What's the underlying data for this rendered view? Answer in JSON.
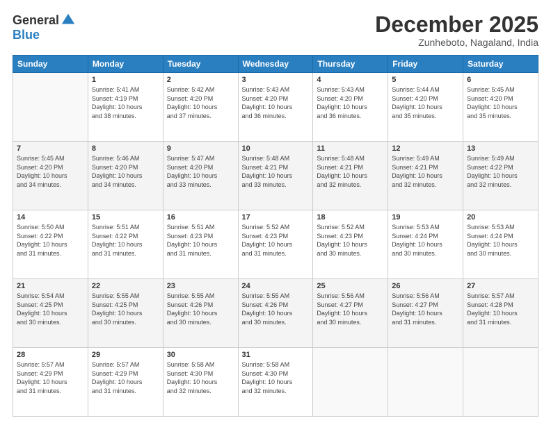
{
  "logo": {
    "general": "General",
    "blue": "Blue"
  },
  "header": {
    "month": "December 2025",
    "location": "Zunheboto, Nagaland, India"
  },
  "days_of_week": [
    "Sunday",
    "Monday",
    "Tuesday",
    "Wednesday",
    "Thursday",
    "Friday",
    "Saturday"
  ],
  "weeks": [
    [
      {
        "day": "",
        "info": ""
      },
      {
        "day": "1",
        "info": "Sunrise: 5:41 AM\nSunset: 4:19 PM\nDaylight: 10 hours\nand 38 minutes."
      },
      {
        "day": "2",
        "info": "Sunrise: 5:42 AM\nSunset: 4:20 PM\nDaylight: 10 hours\nand 37 minutes."
      },
      {
        "day": "3",
        "info": "Sunrise: 5:43 AM\nSunset: 4:20 PM\nDaylight: 10 hours\nand 36 minutes."
      },
      {
        "day": "4",
        "info": "Sunrise: 5:43 AM\nSunset: 4:20 PM\nDaylight: 10 hours\nand 36 minutes."
      },
      {
        "day": "5",
        "info": "Sunrise: 5:44 AM\nSunset: 4:20 PM\nDaylight: 10 hours\nand 35 minutes."
      },
      {
        "day": "6",
        "info": "Sunrise: 5:45 AM\nSunset: 4:20 PM\nDaylight: 10 hours\nand 35 minutes."
      }
    ],
    [
      {
        "day": "7",
        "info": "Sunrise: 5:45 AM\nSunset: 4:20 PM\nDaylight: 10 hours\nand 34 minutes."
      },
      {
        "day": "8",
        "info": "Sunrise: 5:46 AM\nSunset: 4:20 PM\nDaylight: 10 hours\nand 34 minutes."
      },
      {
        "day": "9",
        "info": "Sunrise: 5:47 AM\nSunset: 4:20 PM\nDaylight: 10 hours\nand 33 minutes."
      },
      {
        "day": "10",
        "info": "Sunrise: 5:48 AM\nSunset: 4:21 PM\nDaylight: 10 hours\nand 33 minutes."
      },
      {
        "day": "11",
        "info": "Sunrise: 5:48 AM\nSunset: 4:21 PM\nDaylight: 10 hours\nand 32 minutes."
      },
      {
        "day": "12",
        "info": "Sunrise: 5:49 AM\nSunset: 4:21 PM\nDaylight: 10 hours\nand 32 minutes."
      },
      {
        "day": "13",
        "info": "Sunrise: 5:49 AM\nSunset: 4:22 PM\nDaylight: 10 hours\nand 32 minutes."
      }
    ],
    [
      {
        "day": "14",
        "info": "Sunrise: 5:50 AM\nSunset: 4:22 PM\nDaylight: 10 hours\nand 31 minutes."
      },
      {
        "day": "15",
        "info": "Sunrise: 5:51 AM\nSunset: 4:22 PM\nDaylight: 10 hours\nand 31 minutes."
      },
      {
        "day": "16",
        "info": "Sunrise: 5:51 AM\nSunset: 4:23 PM\nDaylight: 10 hours\nand 31 minutes."
      },
      {
        "day": "17",
        "info": "Sunrise: 5:52 AM\nSunset: 4:23 PM\nDaylight: 10 hours\nand 31 minutes."
      },
      {
        "day": "18",
        "info": "Sunrise: 5:52 AM\nSunset: 4:23 PM\nDaylight: 10 hours\nand 30 minutes."
      },
      {
        "day": "19",
        "info": "Sunrise: 5:53 AM\nSunset: 4:24 PM\nDaylight: 10 hours\nand 30 minutes."
      },
      {
        "day": "20",
        "info": "Sunrise: 5:53 AM\nSunset: 4:24 PM\nDaylight: 10 hours\nand 30 minutes."
      }
    ],
    [
      {
        "day": "21",
        "info": "Sunrise: 5:54 AM\nSunset: 4:25 PM\nDaylight: 10 hours\nand 30 minutes."
      },
      {
        "day": "22",
        "info": "Sunrise: 5:55 AM\nSunset: 4:25 PM\nDaylight: 10 hours\nand 30 minutes."
      },
      {
        "day": "23",
        "info": "Sunrise: 5:55 AM\nSunset: 4:26 PM\nDaylight: 10 hours\nand 30 minutes."
      },
      {
        "day": "24",
        "info": "Sunrise: 5:55 AM\nSunset: 4:26 PM\nDaylight: 10 hours\nand 30 minutes."
      },
      {
        "day": "25",
        "info": "Sunrise: 5:56 AM\nSunset: 4:27 PM\nDaylight: 10 hours\nand 30 minutes."
      },
      {
        "day": "26",
        "info": "Sunrise: 5:56 AM\nSunset: 4:27 PM\nDaylight: 10 hours\nand 31 minutes."
      },
      {
        "day": "27",
        "info": "Sunrise: 5:57 AM\nSunset: 4:28 PM\nDaylight: 10 hours\nand 31 minutes."
      }
    ],
    [
      {
        "day": "28",
        "info": "Sunrise: 5:57 AM\nSunset: 4:29 PM\nDaylight: 10 hours\nand 31 minutes."
      },
      {
        "day": "29",
        "info": "Sunrise: 5:57 AM\nSunset: 4:29 PM\nDaylight: 10 hours\nand 31 minutes."
      },
      {
        "day": "30",
        "info": "Sunrise: 5:58 AM\nSunset: 4:30 PM\nDaylight: 10 hours\nand 32 minutes."
      },
      {
        "day": "31",
        "info": "Sunrise: 5:58 AM\nSunset: 4:30 PM\nDaylight: 10 hours\nand 32 minutes."
      },
      {
        "day": "",
        "info": ""
      },
      {
        "day": "",
        "info": ""
      },
      {
        "day": "",
        "info": ""
      }
    ]
  ]
}
